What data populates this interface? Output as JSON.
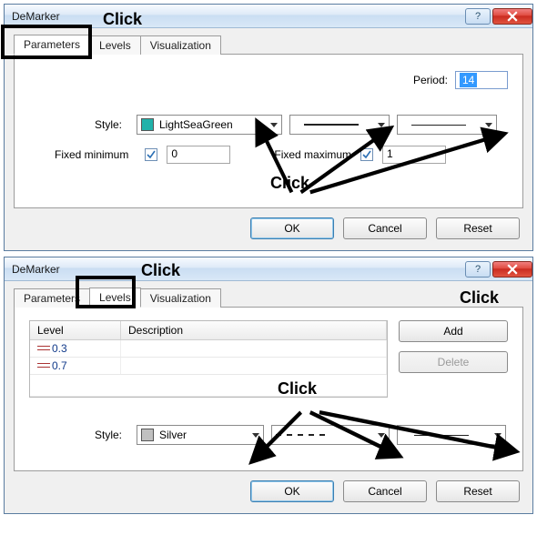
{
  "window1": {
    "title": "DeMarker",
    "tabs": {
      "parameters": "Parameters",
      "levels": "Levels",
      "visualization": "Visualization"
    },
    "period_label": "Period:",
    "period_value": "14",
    "style_label": "Style:",
    "color_name": "LightSeaGreen",
    "color_hex": "#20B2AA",
    "fixed_min_label": "Fixed minimum",
    "fixed_min_checked": true,
    "fixed_min_value": "0",
    "fixed_max_label": "Fixed maximum",
    "fixed_max_checked": true,
    "fixed_max_value": "1",
    "ok": "OK",
    "cancel": "Cancel",
    "reset": "Reset"
  },
  "window2": {
    "title": "DeMarker",
    "tabs": {
      "parameters": "Parameters",
      "levels": "Levels",
      "visualization": "Visualization"
    },
    "grid": {
      "head_level": "Level",
      "head_desc": "Description",
      "rows": [
        {
          "level": "0.3",
          "desc": ""
        },
        {
          "level": "0.7",
          "desc": ""
        }
      ]
    },
    "add": "Add",
    "delete": "Delete",
    "style_label": "Style:",
    "color_name": "Silver",
    "color_hex": "#C0C0C0",
    "ok": "OK",
    "cancel": "Cancel",
    "reset": "Reset"
  },
  "annotations": {
    "click": "Click"
  }
}
